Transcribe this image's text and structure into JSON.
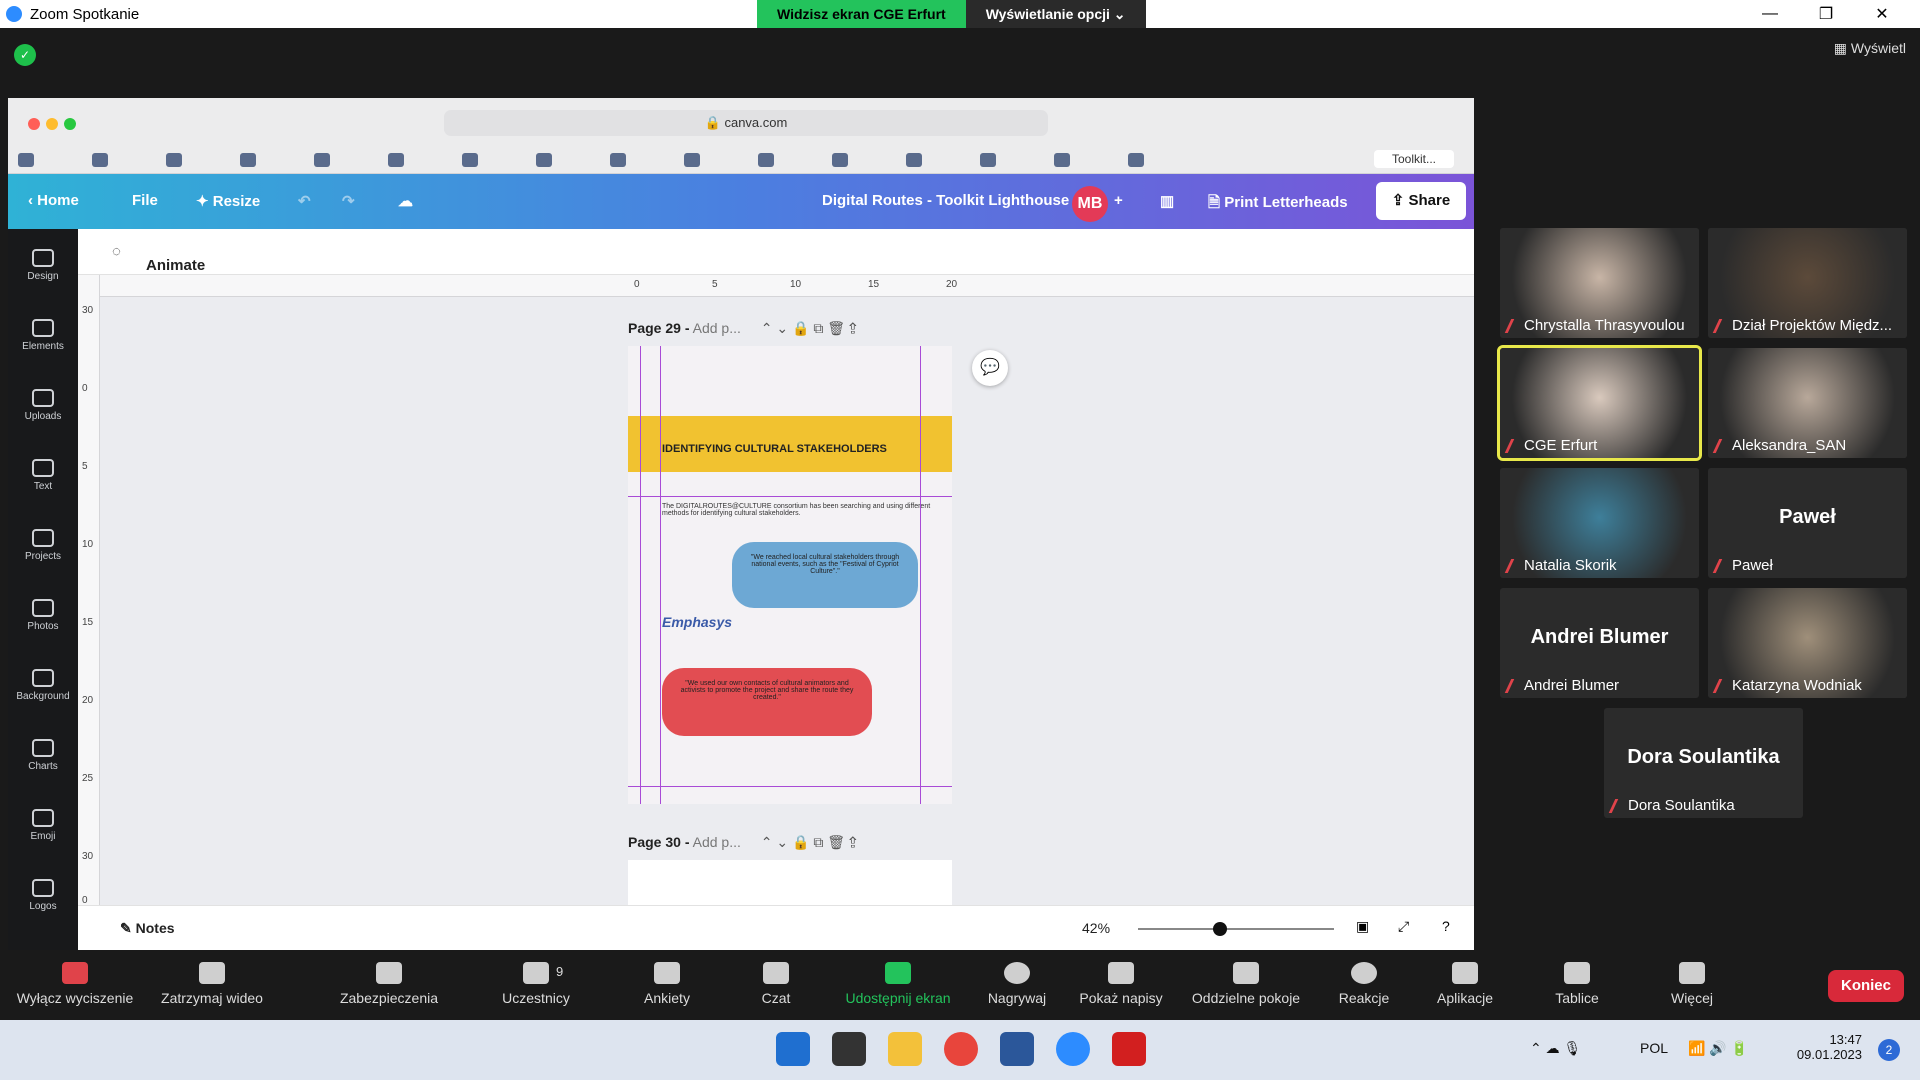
{
  "window": {
    "title": "Zoom Spotkanie",
    "banner_left": "Widzisz ekran CGE Erfurt",
    "banner_right": "Wyświetlanie opcji ⌄",
    "view_label": "Wyświetl"
  },
  "browser": {
    "url": "canva.com",
    "last_tab": "Toolkit..."
  },
  "canva": {
    "home": "Home",
    "file": "File",
    "resize": "Resize",
    "doc_title": "Digital Routes - Toolkit Lighthouse",
    "avatar": "MB",
    "print_label": "Print Letterheads",
    "share": "Share",
    "animate": "Animate",
    "notes": "Notes",
    "zoom_pct": "42%",
    "zoom_level": 0.42
  },
  "sidebar": {
    "items": [
      "Design",
      "Elements",
      "Uploads",
      "Text",
      "Projects",
      "Photos",
      "Background",
      "Charts",
      "Emoji",
      "Logos"
    ]
  },
  "ruler_top": [
    "0",
    "5",
    "10",
    "15",
    "20"
  ],
  "ruler_left": [
    "30",
    "0",
    "5",
    "10",
    "15",
    "20",
    "25",
    "30",
    "0"
  ],
  "pages": {
    "p29_label": "Page 29 -",
    "p29_add": "Add p...",
    "p30_label": "Page 30 -",
    "p30_add": "Add p..."
  },
  "slide": {
    "heading": "IDENTIFYING CULTURAL STAKEHOLDERS",
    "desc": "The DIGITALROUTES@CULTURE consortium has been searching and using different methods for identifying cultural stakeholders.",
    "quote_blue": "\"We reached local cultural stakeholders through national events, such as the \"Festival of Cypriot Culture\".\"",
    "quote_red": "\"We used our own contacts of cultural animators and activists to promote the project and share the route they created.\"",
    "logo": "Emphasys"
  },
  "participants": [
    {
      "name": "Chrystalla Thrasyvoulou"
    },
    {
      "name": "Dział Projektów Międz..."
    },
    {
      "name": "CGE Erfurt"
    },
    {
      "name": "Aleksandra_SAN"
    },
    {
      "name": "Natalia Skorik"
    },
    {
      "name": "Paweł",
      "big": "Paweł"
    },
    {
      "name": "Andrei Blumer",
      "big": "Andrei Blumer"
    },
    {
      "name": "Katarzyna Wodniak"
    },
    {
      "name": "Dora Soulantika",
      "big": "Dora Soulantika"
    }
  ],
  "toolbar": {
    "mute": "Wyłącz wyciszenie",
    "video": "Zatrzymaj wideo",
    "security": "Zabezpieczenia",
    "participants": "Uczestnicy",
    "participants_count": "9",
    "polls": "Ankiety",
    "chat": "Czat",
    "share": "Udostępnij ekran",
    "record": "Nagrywaj",
    "captions": "Pokaż napisy",
    "rooms": "Oddzielne pokoje",
    "reactions": "Reakcje",
    "apps": "Aplikacje",
    "whiteboards": "Tablice",
    "more": "Więcej",
    "end": "Koniec"
  },
  "taskbar": {
    "lang": "POL",
    "time": "13:47",
    "date": "09.01.2023",
    "badge": "2"
  }
}
